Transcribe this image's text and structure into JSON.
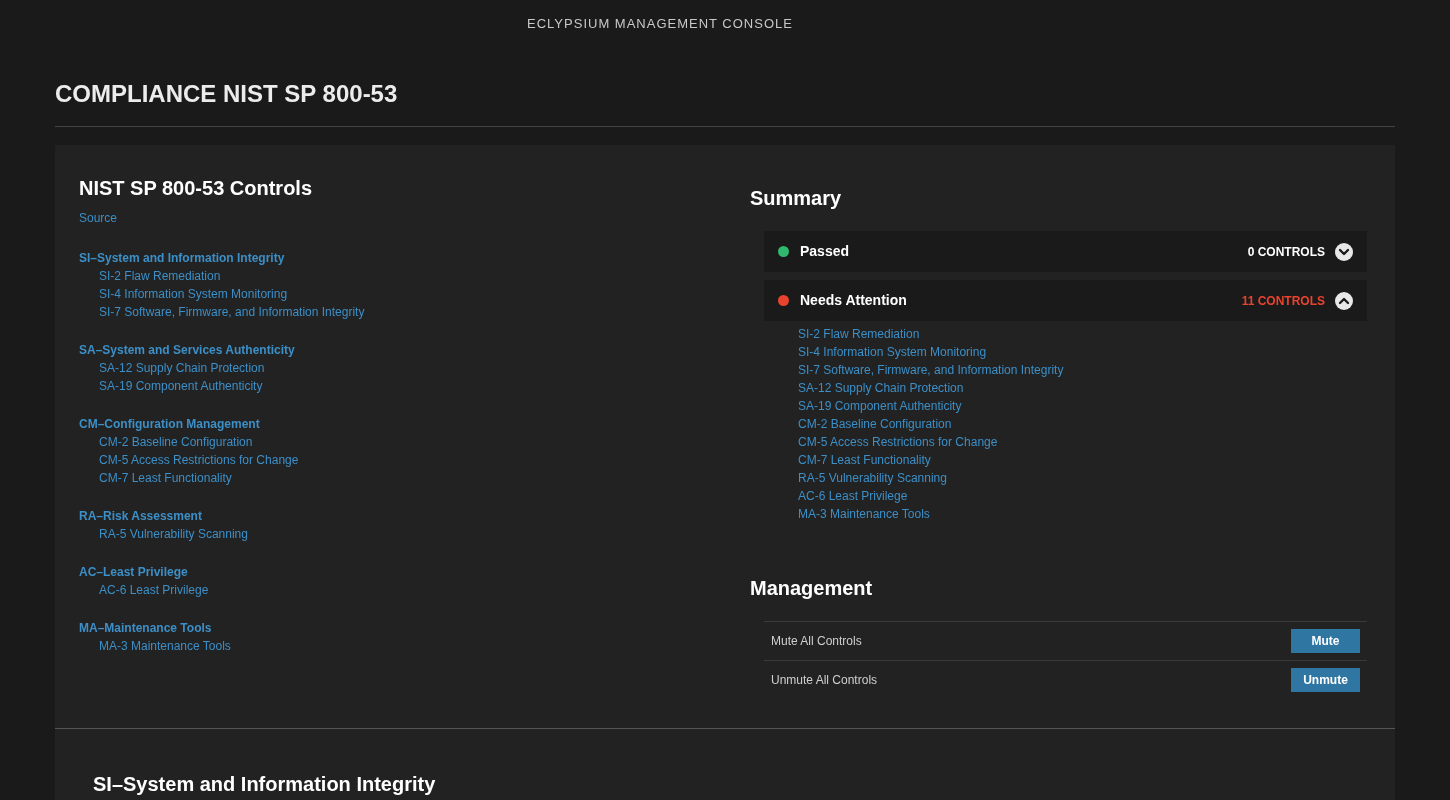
{
  "app_title": "ECLYPSIUM MANAGEMENT CONSOLE",
  "page_title": "COMPLIANCE NIST SP 800-53",
  "controls": {
    "title": "NIST SP 800-53 Controls",
    "source_link": "Source",
    "groups": [
      {
        "label": "SI–System and Information Integrity",
        "children": [
          "SI-2 Flaw Remediation",
          "SI-4 Information System Monitoring",
          "SI-7 Software, Firmware, and Information Integrity"
        ]
      },
      {
        "label": "SA–System and Services Authenticity",
        "children": [
          "SA-12 Supply Chain Protection",
          "SA-19 Component Authenticity"
        ]
      },
      {
        "label": "CM–Configuration Management",
        "children": [
          "CM-2 Baseline Configuration",
          "CM-5 Access Restrictions for Change",
          "CM-7 Least Functionality"
        ]
      },
      {
        "label": "RA–Risk Assessment",
        "children": [
          "RA-5 Vulnerability Scanning"
        ]
      },
      {
        "label": "AC–Least Privilege",
        "children": [
          "AC-6 Least Privilege"
        ]
      },
      {
        "label": "MA–Maintenance Tools",
        "children": [
          "MA-3 Maintenance Tools"
        ]
      }
    ]
  },
  "summary": {
    "title": "Summary",
    "statuses": [
      {
        "kind": "passed",
        "label": "Passed",
        "count": "0 CONTROLS",
        "color": "#2fb86e",
        "expanded": false
      },
      {
        "kind": "attention",
        "label": "Needs Attention",
        "count": "11 CONTROLS",
        "color": "#e8432e",
        "expanded": true,
        "items": [
          "SI-2 Flaw Remediation",
          "SI-4 Information System Monitoring",
          "SI-7 Software, Firmware, and Information Integrity",
          "SA-12 Supply Chain Protection",
          "SA-19 Component Authenticity",
          "CM-2 Baseline Configuration",
          "CM-5 Access Restrictions for Change",
          "CM-7 Least Functionality",
          "RA-5 Vulnerability Scanning",
          "AC-6 Least Privilege",
          "MA-3 Maintenance Tools"
        ]
      }
    ]
  },
  "management": {
    "title": "Management",
    "rows": [
      {
        "label": "Mute All Controls",
        "button": "Mute"
      },
      {
        "label": "Unmute All Controls",
        "button": "Unmute"
      }
    ]
  },
  "section_heading": "SI–System and Information Integrity"
}
